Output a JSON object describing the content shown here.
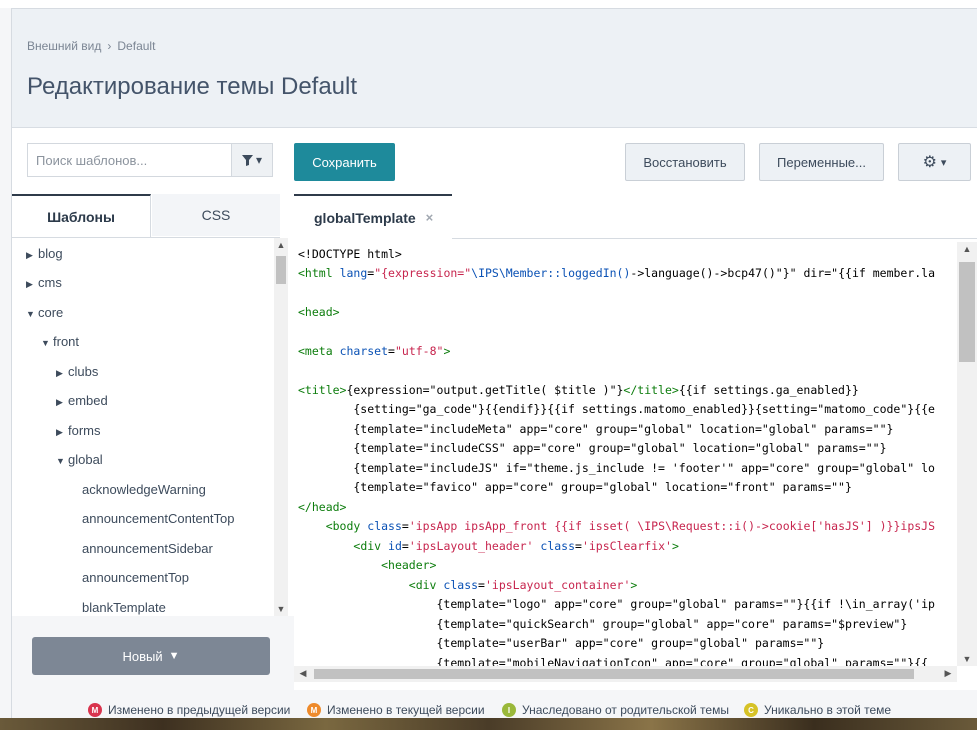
{
  "breadcrumb": {
    "items": [
      "Внешний вид",
      "Default"
    ]
  },
  "page_title": "Редактирование темы Default",
  "toolbar": {
    "search_placeholder": "Поиск шаблонов...",
    "save_label": "Сохранить",
    "restore_label": "Восстановить",
    "variables_label": "Переменные..."
  },
  "sidebar": {
    "tabs": [
      "Шаблоны",
      "CSS"
    ],
    "tree": [
      {
        "label": "blog",
        "expanded": false
      },
      {
        "label": "cms",
        "expanded": false
      },
      {
        "label": "core",
        "expanded": true
      },
      {
        "label": "front",
        "expanded": true
      },
      {
        "label": "clubs",
        "expanded": false
      },
      {
        "label": "embed",
        "expanded": false
      },
      {
        "label": "forms",
        "expanded": false
      },
      {
        "label": "global",
        "expanded": true
      },
      {
        "label": "acknowledgeWarning"
      },
      {
        "label": "announcementContentTop"
      },
      {
        "label": "announcementSidebar"
      },
      {
        "label": "announcementTop"
      },
      {
        "label": "blankTemplate"
      }
    ],
    "new_label": "Новый"
  },
  "editor": {
    "tab_label": "globalTemplate",
    "close_icon": "×"
  },
  "legend": [
    {
      "badge": "M",
      "label": "Изменено в предыдущей версии",
      "color": "#d9344e"
    },
    {
      "badge": "M",
      "label": "Изменено в текущей версии",
      "color": "#ee8a2b"
    },
    {
      "badge": "I",
      "label": "Унаследовано от родительской темы",
      "color": "#9ab83a"
    },
    {
      "badge": "C",
      "label": "Уникально в этой теме",
      "color": "#d6c227"
    }
  ]
}
